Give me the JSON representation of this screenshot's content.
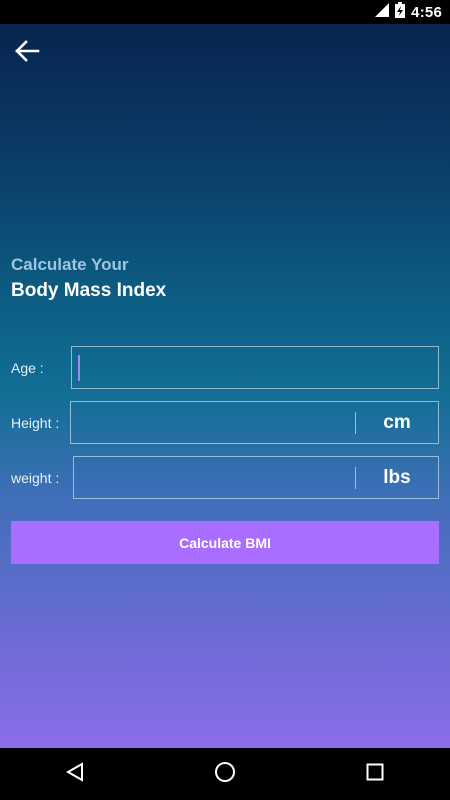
{
  "status_bar": {
    "time": "4:56",
    "icons": [
      "signal-icon",
      "battery-charging-icon"
    ]
  },
  "header": {
    "back_icon": "arrow-back-icon"
  },
  "title": {
    "line1": "Calculate Your",
    "line2": "Body Mass Index"
  },
  "form": {
    "age_label": "Age :",
    "age_value": "",
    "height_label": "Height :",
    "height_value": "",
    "height_unit": "cm",
    "weight_label": "weight :",
    "weight_value": "",
    "weight_unit": "lbs"
  },
  "actions": {
    "calculate_label": "Calculate BMI"
  },
  "nav_bar": {
    "icons": [
      "back-triangle-icon",
      "home-circle-icon",
      "recents-square-icon"
    ]
  },
  "colors": {
    "gradient_top": "#07204a",
    "gradient_mid": "#136f96",
    "gradient_bottom": "#9a6df4",
    "button": "#a96dff",
    "title_small": "#9dc6e0"
  }
}
